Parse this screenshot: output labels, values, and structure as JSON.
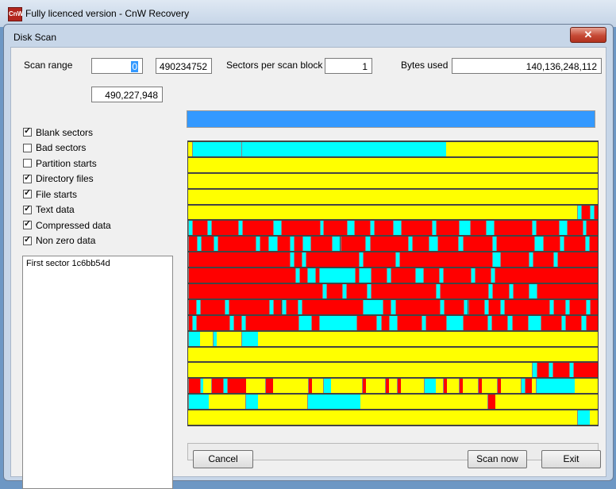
{
  "app": {
    "title": "Fully licenced version - CnW Recovery",
    "icon_text": "CnW"
  },
  "dialog": {
    "title": "Disk Scan",
    "close_label": "✕"
  },
  "scan": {
    "range_label": "Scan range",
    "range_start": "0",
    "range_end": "490234752",
    "sectors_per_block_label": "Sectors per scan block",
    "sectors_per_block": "1",
    "bytes_used_label": "Bytes used",
    "bytes_used": "140,136,248,112",
    "current_sector": "490,227,948",
    "progress": 1.0
  },
  "options": [
    {
      "label": "Blank sectors",
      "checked": true
    },
    {
      "label": "Bad sectors",
      "checked": false
    },
    {
      "label": "Partition starts",
      "checked": false
    },
    {
      "label": "Directory files",
      "checked": true
    },
    {
      "label": "File starts",
      "checked": true
    },
    {
      "label": "Text data",
      "checked": true
    },
    {
      "label": "Compressed data",
      "checked": true
    },
    {
      "label": "Non zero data",
      "checked": true
    }
  ],
  "info": {
    "first_sector": "First sector 1c6bb54d"
  },
  "buttons": {
    "cancel": "Cancel",
    "scan_now": "Scan now",
    "exit": "Exit"
  },
  "colors": {
    "blank": "#ffff00",
    "compressed": "#ff0000",
    "text": "#00ffff",
    "boundary": "#888888"
  },
  "disk_map": [
    [
      [
        "y",
        1
      ],
      [
        "c",
        12
      ],
      [
        "c",
        50
      ],
      [
        "y",
        37
      ]
    ],
    [
      [
        "y",
        100
      ]
    ],
    [
      [
        "y",
        100
      ]
    ],
    [
      [
        "y",
        100
      ]
    ],
    [
      [
        "y",
        95
      ],
      [
        "c",
        1
      ],
      [
        "r",
        2
      ],
      [
        "c",
        1
      ],
      [
        "r",
        1
      ]
    ],
    [
      [
        "c",
        1
      ],
      [
        "r",
        4
      ],
      [
        "c",
        1
      ],
      [
        "r",
        7
      ],
      [
        "c",
        1
      ],
      [
        "r",
        8
      ],
      [
        "c",
        2
      ],
      [
        "r",
        10
      ],
      [
        "c",
        1
      ],
      [
        "r",
        6
      ],
      [
        "c",
        2
      ],
      [
        "r",
        4
      ],
      [
        "c",
        1
      ],
      [
        "r",
        5
      ],
      [
        "c",
        2
      ],
      [
        "r",
        8
      ],
      [
        "c",
        1
      ],
      [
        "r",
        6
      ],
      [
        "c",
        3
      ],
      [
        "r",
        4
      ],
      [
        "c",
        2
      ],
      [
        "r",
        10
      ],
      [
        "c",
        1
      ],
      [
        "r",
        6
      ],
      [
        "c",
        2
      ],
      [
        "r",
        4
      ],
      [
        "c",
        1
      ],
      [
        "r",
        3
      ]
    ],
    [
      [
        "r",
        2
      ],
      [
        "c",
        1
      ],
      [
        "r",
        3
      ],
      [
        "c",
        1
      ],
      [
        "r",
        9
      ],
      [
        "c",
        1
      ],
      [
        "r",
        2
      ],
      [
        "c",
        2
      ],
      [
        "r",
        3
      ],
      [
        "c",
        1
      ],
      [
        "r",
        2
      ],
      [
        "c",
        2
      ],
      [
        "r",
        5
      ],
      [
        "c",
        2
      ],
      [
        "r",
        6
      ],
      [
        "c",
        1
      ],
      [
        "r",
        9
      ],
      [
        "c",
        1
      ],
      [
        "r",
        4
      ],
      [
        "c",
        2
      ],
      [
        "r",
        5
      ],
      [
        "c",
        1
      ],
      [
        "r",
        7
      ],
      [
        "c",
        1
      ],
      [
        "r",
        9
      ],
      [
        "c",
        2
      ],
      [
        "r",
        4
      ],
      [
        "c",
        1
      ],
      [
        "r",
        5
      ],
      [
        "c",
        1
      ],
      [
        "r",
        2
      ]
    ],
    [
      [
        "r",
        25
      ],
      [
        "c",
        1
      ],
      [
        "r",
        2
      ],
      [
        "c",
        1
      ],
      [
        "r",
        13
      ],
      [
        "c",
        1
      ],
      [
        "r",
        8
      ],
      [
        "c",
        1
      ],
      [
        "r",
        23
      ],
      [
        "c",
        2
      ],
      [
        "r",
        7
      ],
      [
        "c",
        1
      ],
      [
        "r",
        5
      ],
      [
        "c",
        1
      ],
      [
        "r",
        10
      ]
    ],
    [
      [
        "r",
        27
      ],
      [
        "c",
        1
      ],
      [
        "r",
        2
      ],
      [
        "c",
        2
      ],
      [
        "r",
        1
      ],
      [
        "c",
        9
      ],
      [
        "r",
        1
      ],
      [
        "c",
        3
      ],
      [
        "r",
        4
      ],
      [
        "c",
        1
      ],
      [
        "r",
        6
      ],
      [
        "c",
        2
      ],
      [
        "r",
        4
      ],
      [
        "c",
        1
      ],
      [
        "r",
        7
      ],
      [
        "c",
        1
      ],
      [
        "r",
        4
      ],
      [
        "c",
        1
      ],
      [
        "r",
        26
      ]
    ],
    [
      [
        "r",
        33
      ],
      [
        "c",
        1
      ],
      [
        "r",
        4
      ],
      [
        "c",
        1
      ],
      [
        "r",
        5
      ],
      [
        "c",
        1
      ],
      [
        "r",
        16
      ],
      [
        "c",
        1
      ],
      [
        "r",
        12
      ],
      [
        "c",
        1
      ],
      [
        "r",
        4
      ],
      [
        "c",
        1
      ],
      [
        "r",
        4
      ],
      [
        "c",
        2
      ],
      [
        "r",
        15
      ]
    ],
    [
      [
        "r",
        2
      ],
      [
        "c",
        1
      ],
      [
        "r",
        6
      ],
      [
        "c",
        1
      ],
      [
        "r",
        10
      ],
      [
        "c",
        1
      ],
      [
        "r",
        2
      ],
      [
        "c",
        1
      ],
      [
        "r",
        3
      ],
      [
        "c",
        1
      ],
      [
        "r",
        15
      ],
      [
        "c",
        5
      ],
      [
        "r",
        2
      ],
      [
        "c",
        1
      ],
      [
        "r",
        11
      ],
      [
        "c",
        1
      ],
      [
        "r",
        5
      ],
      [
        "c",
        1
      ],
      [
        "r",
        4
      ],
      [
        "c",
        1
      ],
      [
        "r",
        3
      ],
      [
        "c",
        1
      ],
      [
        "r",
        11
      ],
      [
        "c",
        1
      ],
      [
        "r",
        3
      ],
      [
        "c",
        1
      ],
      [
        "r",
        4
      ],
      [
        "c",
        1
      ],
      [
        "r",
        2
      ]
    ],
    [
      [
        "r",
        1
      ],
      [
        "c",
        1
      ],
      [
        "r",
        8
      ],
      [
        "c",
        1
      ],
      [
        "r",
        2
      ],
      [
        "c",
        1
      ],
      [
        "r",
        13
      ],
      [
        "c",
        3
      ],
      [
        "r",
        2
      ],
      [
        "c",
        9
      ],
      [
        "r",
        5
      ],
      [
        "c",
        1
      ],
      [
        "r",
        2
      ],
      [
        "c",
        2
      ],
      [
        "r",
        6
      ],
      [
        "c",
        1
      ],
      [
        "r",
        5
      ],
      [
        "c",
        4
      ],
      [
        "r",
        6
      ],
      [
        "c",
        1
      ],
      [
        "r",
        4
      ],
      [
        "c",
        1
      ],
      [
        "r",
        4
      ],
      [
        "c",
        3
      ],
      [
        "r",
        5
      ],
      [
        "c",
        1
      ],
      [
        "r",
        4
      ],
      [
        "c",
        1
      ],
      [
        "r",
        3
      ]
    ],
    [
      [
        "c",
        3
      ],
      [
        "y",
        3
      ],
      [
        "c",
        1
      ],
      [
        "y",
        6
      ],
      [
        "c",
        4
      ],
      [
        "y",
        83
      ]
    ],
    [
      [
        "y",
        100
      ]
    ],
    [
      [
        "y",
        84
      ],
      [
        "c",
        1
      ],
      [
        "r",
        3
      ],
      [
        "c",
        1
      ],
      [
        "r",
        4
      ],
      [
        "c",
        1
      ],
      [
        "r",
        6
      ]
    ],
    [
      [
        "r",
        3
      ],
      [
        "c",
        1
      ],
      [
        "y",
        2
      ],
      [
        "r",
        3
      ],
      [
        "c",
        1
      ],
      [
        "r",
        5
      ],
      [
        "y",
        5
      ],
      [
        "r",
        2
      ],
      [
        "y",
        9
      ],
      [
        "r",
        1
      ],
      [
        "y",
        3
      ],
      [
        "c",
        2
      ],
      [
        "y",
        8
      ],
      [
        "r",
        1
      ],
      [
        "y",
        5
      ],
      [
        "r",
        1
      ],
      [
        "y",
        2
      ],
      [
        "r",
        1
      ],
      [
        "y",
        6
      ],
      [
        "c",
        3
      ],
      [
        "y",
        2
      ],
      [
        "r",
        1
      ],
      [
        "y",
        3
      ],
      [
        "r",
        1
      ],
      [
        "y",
        4
      ],
      [
        "r",
        1
      ],
      [
        "y",
        4
      ],
      [
        "r",
        1
      ],
      [
        "y",
        5
      ],
      [
        "c",
        1
      ],
      [
        "r",
        2
      ],
      [
        "y",
        1
      ],
      [
        "c",
        10
      ],
      [
        "y",
        6
      ]
    ],
    [
      [
        "c",
        5
      ],
      [
        "y",
        9
      ],
      [
        "c",
        3
      ],
      [
        "y",
        12
      ],
      [
        "c",
        13
      ],
      [
        "y",
        31
      ],
      [
        "r",
        2
      ],
      [
        "y",
        25
      ]
    ],
    [
      [
        "y",
        95
      ],
      [
        "c",
        3
      ],
      [
        "y",
        2
      ]
    ]
  ]
}
